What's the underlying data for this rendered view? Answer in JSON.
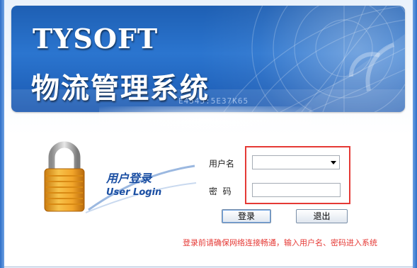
{
  "banner": {
    "title": "TYSOFT",
    "subtitle": "物流管理系统",
    "code": "E4545:5E37K65"
  },
  "login": {
    "title_cn": "用户登录",
    "title_en": "User Login"
  },
  "form": {
    "username_label": "用户名",
    "username_value": "",
    "password_label": "密  码",
    "password_value": ""
  },
  "buttons": {
    "login": "登录",
    "exit": "退出"
  },
  "notice": "登录前请确保网络连接畅通，输入用户名、密码进入系统",
  "colors": {
    "banner_blue": "#2b75cf",
    "accent_blue": "#1b4fa3",
    "highlight_red": "#e53935"
  }
}
